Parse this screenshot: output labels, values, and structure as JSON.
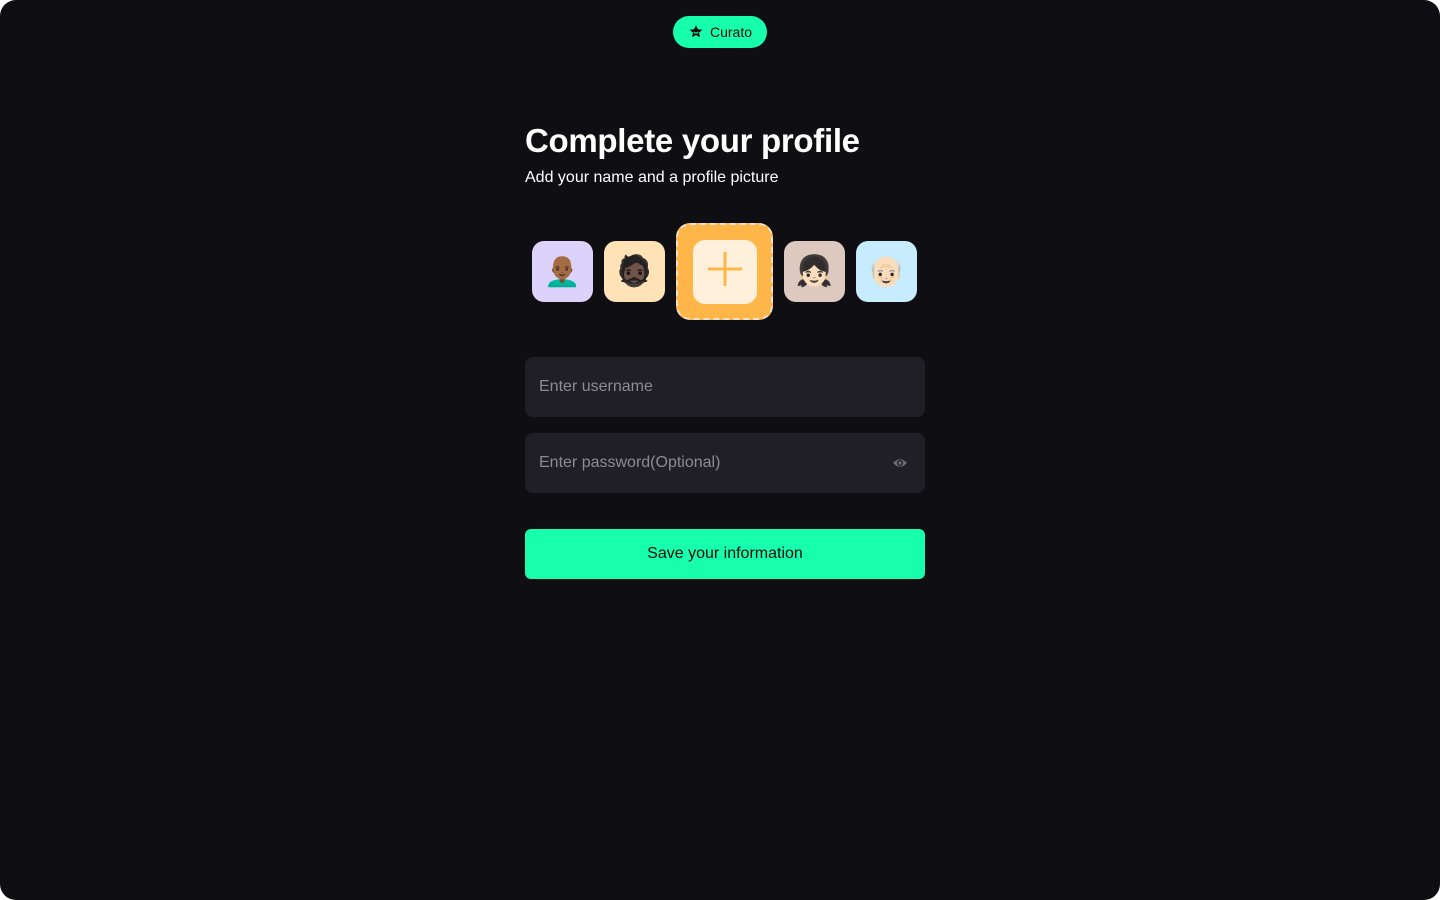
{
  "brand": {
    "name": "Curato",
    "icon": "star-badge-icon",
    "color": "#17ffac"
  },
  "header": {
    "title": "Complete your profile",
    "subtitle": "Add your name and a profile picture"
  },
  "avatars": [
    {
      "name": "avatar-bald-man",
      "glyph": "👨🏾‍🦲",
      "bg": "#dcd2fb"
    },
    {
      "name": "avatar-sunglasses-person",
      "glyph": "🧔🏿",
      "bg": "#ffe3b6"
    },
    {
      "name": "avatar-add-new",
      "glyph": "+",
      "bg": "#ffb648",
      "selected": true
    },
    {
      "name": "avatar-girl-buns",
      "glyph": "👧🏻",
      "bg": "#ddc9bf"
    },
    {
      "name": "avatar-man-hat",
      "glyph": "👴🏻",
      "bg": "#c6ecfd"
    }
  ],
  "form": {
    "username": {
      "value": "",
      "placeholder": "Enter username"
    },
    "password": {
      "value": "",
      "placeholder": "Enter password(Optional)",
      "toggle_icon": "eye-icon"
    }
  },
  "actions": {
    "save_label": "Save your information"
  }
}
